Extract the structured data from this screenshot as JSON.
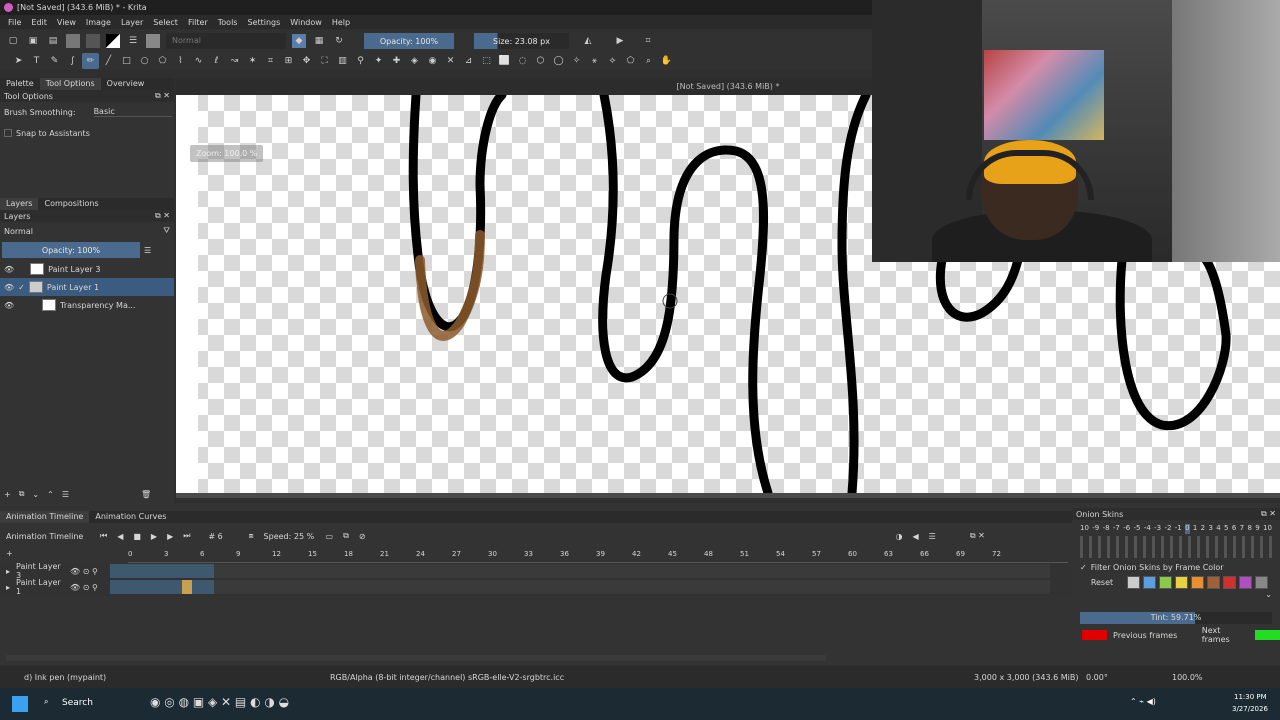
{
  "window": {
    "title": "[Not Saved]  (343.6 MiB) * - Krita"
  },
  "menu": [
    "File",
    "Edit",
    "View",
    "Image",
    "Layer",
    "Select",
    "Filter",
    "Tools",
    "Settings",
    "Window",
    "Help"
  ],
  "toolbar": {
    "blend_mode": "Normal",
    "opacity": "Opacity: 100%",
    "size": "Size: 23.08 px"
  },
  "left_tabs": [
    "Palette",
    "Tool Options",
    "Overview"
  ],
  "tool_options": {
    "header": "Tool Options",
    "brush_smoothing_label": "Brush Smoothing:",
    "brush_smoothing_value": "Basic",
    "snap": "Snap to Assistants"
  },
  "layers": {
    "tabs": [
      "Layers",
      "Compositions"
    ],
    "header": "Layers",
    "blend": "Normal",
    "opacity": "Opacity:  100%",
    "items": [
      {
        "name": "Paint Layer 3",
        "selected": false
      },
      {
        "name": "Paint Layer 1",
        "selected": true
      },
      {
        "name": "Transparency Ma...",
        "selected": false
      }
    ]
  },
  "canvas": {
    "doc_title": "[Not Saved]  (343.6 MiB) *",
    "zoom_popup": "Zoom: 100.0 %"
  },
  "animation": {
    "tabs": [
      "Animation Timeline",
      "Animation Curves"
    ],
    "header": "Animation Timeline",
    "frame": "# 6",
    "speed": "Speed: 25 %",
    "ruler": [
      "0",
      "3",
      "6",
      "9",
      "12",
      "15",
      "18",
      "21",
      "24",
      "27",
      "30",
      "33",
      "36",
      "39",
      "42",
      "45",
      "48",
      "51",
      "54",
      "57",
      "60",
      "63",
      "66",
      "69",
      "72"
    ],
    "layers": [
      "Paint Layer 3",
      "Paint Layer 1"
    ]
  },
  "onion": {
    "header": "Onion Skins",
    "scale": [
      "10",
      "9",
      "8",
      "7",
      "6",
      "5",
      "4",
      "3",
      "2",
      "1",
      "0",
      "1",
      "2",
      "3",
      "4",
      "5",
      "6",
      "7",
      "8",
      "9",
      "10"
    ],
    "filter": "Filter Onion Skins by Frame Color",
    "reset": "Reset",
    "tint": "Tint: 59.71%",
    "previous": "Previous frames",
    "next": "Next frames",
    "prev_color": "#e00000",
    "next_color": "#22dd22"
  },
  "status": {
    "brush": "d) Ink pen (mypaint)",
    "color": "RGB/Alpha (8-bit integer/channel)  sRGB-elle-V2-srgbtrc.icc",
    "dims": "3,000 x 3,000 (343.6 MiB)",
    "rotation": "0.00°",
    "zoom": "100.0%"
  },
  "taskbar": {
    "search": "Search",
    "time": "11:30 PM",
    "date": "3/27/2026"
  }
}
